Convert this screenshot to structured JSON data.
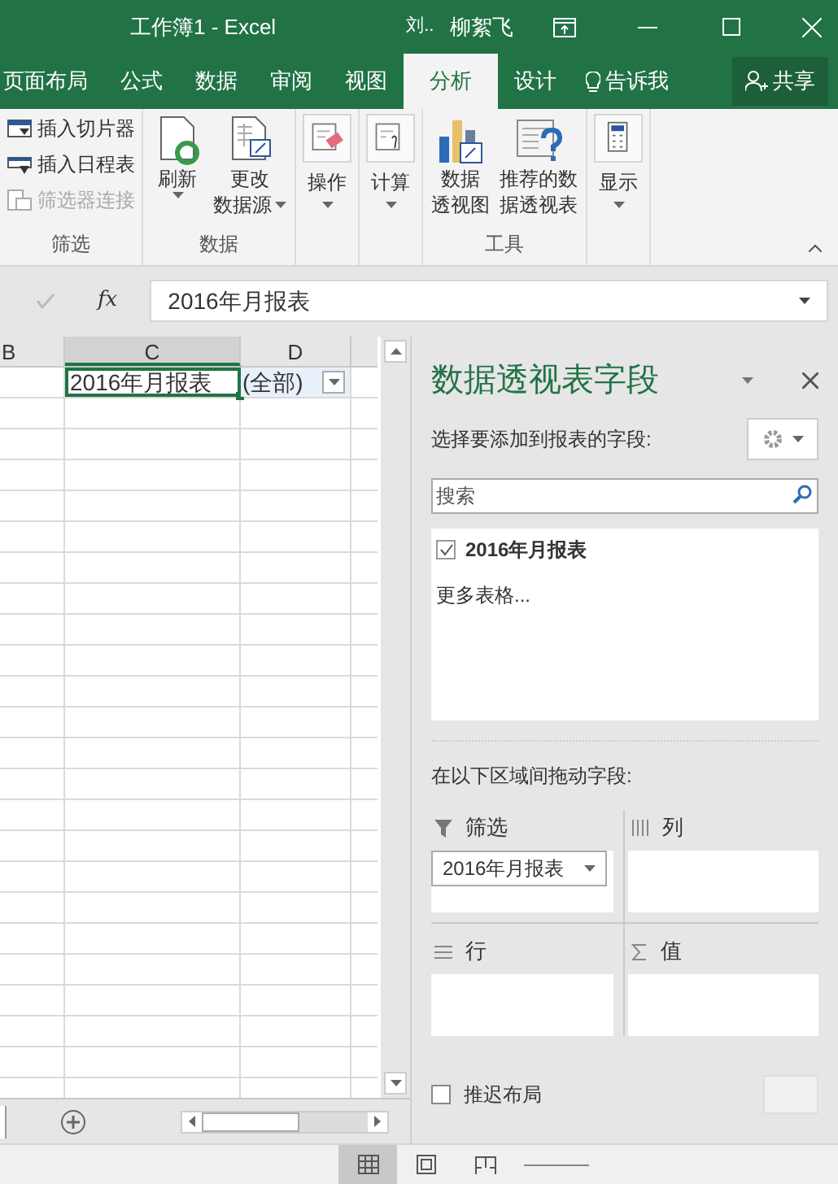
{
  "title_bar": {
    "title": "工作簿1 - Excel",
    "user_initial": "刘..",
    "user_name": "柳絮飞"
  },
  "tabs": [
    {
      "label": "页面布局",
      "selected": false,
      "kind": "tab"
    },
    {
      "label": "公式",
      "selected": false,
      "kind": "tab"
    },
    {
      "label": "数据",
      "selected": false,
      "kind": "tab"
    },
    {
      "label": "审阅",
      "selected": false,
      "kind": "tab"
    },
    {
      "label": "视图",
      "selected": false,
      "kind": "tab"
    },
    {
      "label": "分析",
      "selected": true,
      "kind": "tab"
    },
    {
      "label": "设计",
      "selected": false,
      "kind": "tab"
    },
    {
      "label": "告诉我",
      "selected": false,
      "kind": "tellme"
    },
    {
      "label": "共享",
      "selected": false,
      "kind": "share"
    }
  ],
  "ribbon_groups": [
    {
      "name": "筛选",
      "items": [
        {
          "kind": "small",
          "label": "插入切片器",
          "disabled": false
        },
        {
          "kind": "small",
          "label": "插入日程表",
          "disabled": false
        },
        {
          "kind": "small",
          "label": "筛选器连接",
          "disabled": true
        }
      ]
    },
    {
      "name": "数据",
      "items": [
        {
          "kind": "large",
          "lines": [
            "刷新"
          ],
          "caret": true
        },
        {
          "kind": "large",
          "lines": [
            "更改",
            "数据源"
          ],
          "caret": true
        }
      ]
    },
    {
      "items": [
        {
          "kind": "boxed",
          "lines": [
            "操作"
          ],
          "caret": true
        }
      ]
    },
    {
      "items": [
        {
          "kind": "boxed",
          "lines": [
            "计算"
          ],
          "caret": true
        }
      ]
    },
    {
      "name": "工具",
      "items": [
        {
          "kind": "large",
          "lines": [
            "数据",
            "透视图"
          ],
          "caret": false
        },
        {
          "kind": "large",
          "lines": [
            "推荐的数",
            "据透视表"
          ],
          "caret": false
        }
      ]
    },
    {
      "items": [
        {
          "kind": "boxed",
          "lines": [
            "显示"
          ],
          "caret": true
        }
      ]
    }
  ],
  "formula_bar": {
    "function_label": "fx",
    "value": "2016年月报表"
  },
  "grid": {
    "columns": [
      {
        "label": "B",
        "selected": false
      },
      {
        "label": "C",
        "selected": true
      },
      {
        "label": "D",
        "selected": false
      }
    ],
    "cells": [
      {
        "text": "2016年月报表",
        "selected": true,
        "dropdown": false
      },
      {
        "text": "(全部)",
        "selected": false,
        "dropdown": true
      }
    ]
  },
  "pane": {
    "title": "数据透视表字段",
    "subtitle": "选择要添加到报表的字段:",
    "search": {
      "placeholder": "搜索"
    },
    "fields": [
      {
        "label": "2016年月报表",
        "checked": true
      }
    ],
    "more": "更多表格...",
    "areas_label": "在以下区域间拖动字段:",
    "areas": [
      {
        "kind": "filter",
        "label": "筛选",
        "items": [
          "2016年月报表"
        ]
      },
      {
        "kind": "columns",
        "label": "列"
      },
      {
        "kind": "rows",
        "label": "行"
      },
      {
        "kind": "values",
        "label": "值"
      }
    ],
    "defer": {
      "label": "推迟布局",
      "checked": false
    }
  },
  "status_bar": {
    "views": [
      {
        "kind": "normal",
        "selected": true
      },
      {
        "kind": "layout",
        "selected": false
      },
      {
        "kind": "break",
        "selected": false
      }
    ]
  }
}
